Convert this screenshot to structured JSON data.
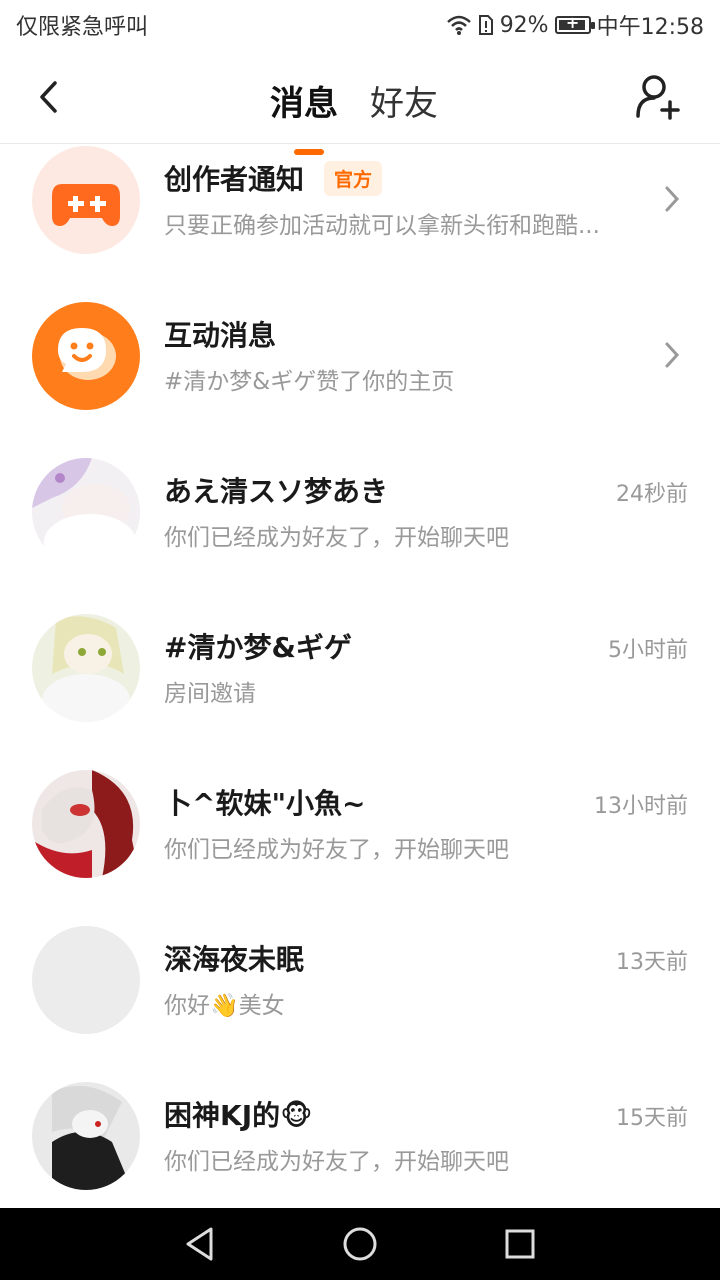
{
  "status_bar": {
    "carrier_text": "仅限紧急呼叫",
    "battery_percent": "92%",
    "battery_level": 0.92,
    "time": "中午12:58",
    "icons": [
      "wifi-icon",
      "sim-icon",
      "battery-icon"
    ]
  },
  "header": {
    "tabs": [
      {
        "label": "消息",
        "active": true
      },
      {
        "label": "好友",
        "active": false
      }
    ],
    "accent_color": "#ff6a00"
  },
  "conversations": [
    {
      "name": "创作者通知",
      "badge": "官方",
      "preview": "只要正确参加活动就可以拿新头衔和跑酷...",
      "time": "",
      "avatar": "gamepad-icon",
      "avatar_bg": "#fde9e2"
    },
    {
      "name": "互动消息",
      "badge": "",
      "preview": "#清か梦&ギゲ赞了你的主页",
      "time": "",
      "avatar": "chat-bubble-icon",
      "avatar_bg": "#ff7d1a"
    },
    {
      "name": "あえ清スソ梦あき",
      "badge": "",
      "preview": "你们已经成为好友了，开始聊天吧",
      "time": "24秒前",
      "avatar": "user-avatar"
    },
    {
      "name": "#清か梦&ギゲ",
      "badge": "",
      "preview": "房间邀请",
      "time": "5小时前",
      "avatar": "user-avatar"
    },
    {
      "name": "卜^软妹\"小魚~",
      "badge": "",
      "preview": "你们已经成为好友了，开始聊天吧",
      "time": "13小时前",
      "avatar": "user-avatar"
    },
    {
      "name": "深海夜未眠",
      "badge": "",
      "preview": "你好👋美女",
      "time": "13天前",
      "avatar": "user-avatar"
    },
    {
      "name": "困神KJ的🐵",
      "badge": "",
      "preview": "你们已经成为好友了，开始聊天吧",
      "time": "15天前",
      "avatar": "user-avatar"
    }
  ],
  "nav_bar": {
    "buttons": [
      "back-triangle-icon",
      "home-circle-icon",
      "recents-square-icon"
    ]
  }
}
